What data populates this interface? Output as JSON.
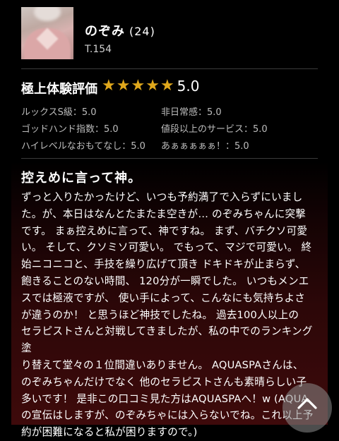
{
  "profile": {
    "name": "のぞみ",
    "age": "(24)",
    "height": "T.154"
  },
  "rating": {
    "title": "極上体験評価",
    "stars": 5,
    "score": "5.0"
  },
  "criteria": [
    {
      "label": "ルックスS級：5.0"
    },
    {
      "label": "非日常感：5.0"
    },
    {
      "label": "ゴッドハンド指数：5.0"
    },
    {
      "label": "値段以上のサービス：5.0"
    },
    {
      "label": "ハイレベルなおもてなし：5.0"
    },
    {
      "label": "あぁぁぁぁぁ！：5.0"
    }
  ],
  "review": {
    "title": "控えめに言って神。",
    "lines": [
      "ずっと入りたかったけど、いつも予約満了で入らずにいまし",
      "た。が、本日はなんとたまたま空きが… のぞみちゃんに突撃",
      "です。 まぁ控えめに言って、神ですね。 まず、バチクソ可愛",
      "い。 そして、クソミソ可愛い。 でもって、マジで可愛い。 終",
      "始ニコニコと、手技を繰り広げて頂き ドキドキが止まらず、",
      "飽きることのない時間、 120分が一瞬でした。 いつもメンエ",
      "スでは極液ですが、 使い手によって、こんなにも気持ちよさ",
      "が違うのか！ と思うほど神技でしたね。 過去100人以上の",
      "セラピストさんと対戦してきましたが、私の中でのランキング塗",
      "り替えて堂々の１位間違いありません。 AQUASPAさんは、",
      "のぞみちゃんだけでなく 他のセラピストさんも素晴らしい子",
      "多いです！ 是非この口コミ見た方はAQUASPAへ！w (AQUA",
      "の宣伝はしますが、のぞみちゃには入らないでね。これ以上予",
      "約が困難になると私が困りますので。)"
    ]
  },
  "colors": {
    "star": "#e0a81c",
    "background_bottom": "#3e0a0b"
  },
  "icons": {
    "scroll_top": "chevron-up-icon"
  }
}
